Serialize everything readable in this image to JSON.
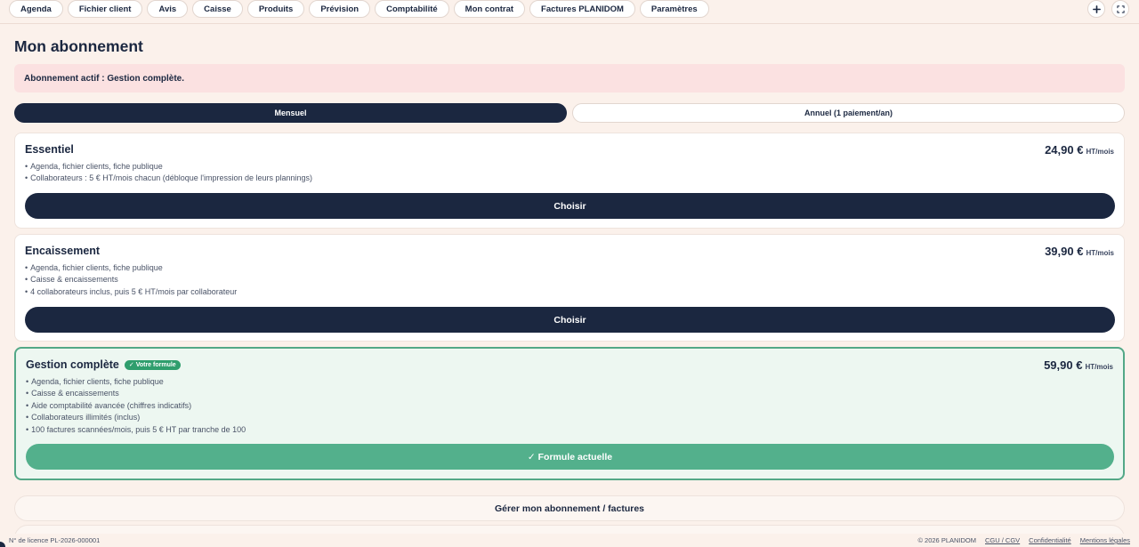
{
  "nav": {
    "items": [
      {
        "label": "Agenda"
      },
      {
        "label": "Fichier client"
      },
      {
        "label": "Avis"
      },
      {
        "label": "Caisse"
      },
      {
        "label": "Produits"
      },
      {
        "label": "Prévision"
      },
      {
        "label": "Comptabilité"
      },
      {
        "label": "Mon contrat"
      },
      {
        "label": "Factures PLANIDOM"
      },
      {
        "label": "Paramètres"
      }
    ],
    "add_icon": "plus-icon",
    "fullscreen_icon": "fullscreen-icon"
  },
  "page": {
    "title": "Mon abonnement",
    "alert": "Abonnement actif : Gestion complète."
  },
  "billing_toggle": {
    "monthly": "Mensuel",
    "yearly": "Annuel (1 paiement/an)"
  },
  "plans": [
    {
      "name": "Essentiel",
      "price": "24,90 €",
      "unit": "HT/mois",
      "features": [
        "Agenda, fichier clients, fiche publique",
        "Collaborateurs : 5 € HT/mois chacun (débloque l'impression de leurs plannings)"
      ],
      "button": "Choisir"
    },
    {
      "name": "Encaissement",
      "price": "39,90 €",
      "unit": "HT/mois",
      "features": [
        "Agenda, fichier clients, fiche publique",
        "Caisse & encaissements",
        "4 collaborateurs inclus, puis 5 € HT/mois par collaborateur"
      ],
      "button": "Choisir"
    },
    {
      "name": "Gestion complète",
      "badge": "✓ Votre formule",
      "price": "59,90 €",
      "unit": "HT/mois",
      "features": [
        "Agenda, fichier clients, fiche publique",
        "Caisse & encaissements",
        "Aide comptabilité avancée (chiffres indicatifs)",
        "Collaborateurs illimités (inclus)",
        "100 factures scannées/mois, puis 5 € HT par tranche de 100"
      ],
      "button": "✓ Formule actuelle"
    }
  ],
  "manage_button": "Gérer mon abonnement / factures",
  "footer": {
    "license": "N° de licence PL-2026-000001",
    "copyright": "© 2026 PLANIDOM",
    "links": [
      "CGU / CGV",
      "Confidentialité",
      "Mentions légales"
    ]
  },
  "colors": {
    "primary": "#1b2740",
    "background": "#fbf1eb",
    "alert": "#fbe1e1",
    "success": "#53b08c",
    "success_border": "#53a887",
    "current_bg": "#edf7f1"
  }
}
